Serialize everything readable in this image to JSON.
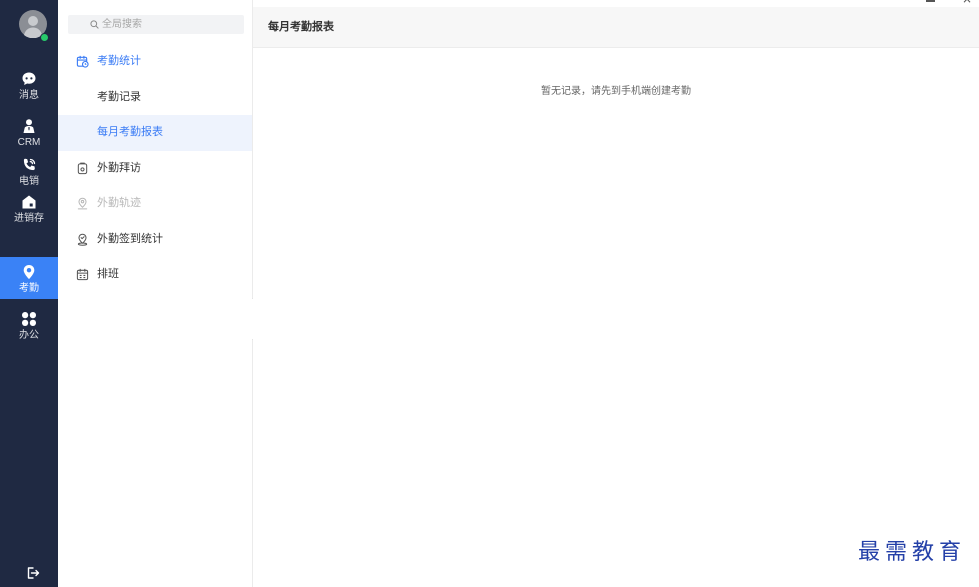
{
  "window_controls": {
    "minimize_icon": "minimize-icon",
    "close_icon": "close-icon",
    "close_glyph": "×"
  },
  "nav": {
    "avatar_icon": "user-avatar",
    "items": [
      {
        "label": "消息",
        "icon": "chat-icon",
        "active": false
      },
      {
        "label": "CRM",
        "icon": "user-icon",
        "active": false
      },
      {
        "label": "电销",
        "icon": "phone-icon",
        "active": false
      },
      {
        "label": "进销存",
        "icon": "store-icon",
        "active": false
      },
      {
        "label": "考勤",
        "icon": "location-pin-icon",
        "active": true
      },
      {
        "label": "办公",
        "icon": "apps-grid-icon",
        "active": false
      }
    ],
    "logout_icon": "logout-icon"
  },
  "submenu": {
    "search_icon": "search-icon",
    "search_placeholder": "全局搜索",
    "search_value": "",
    "items": [
      {
        "label": "考勤统计",
        "icon": "calendar-clock-icon",
        "group": true,
        "expanded": true
      },
      {
        "label": "考勤记录",
        "sub": true
      },
      {
        "label": "每月考勤报表",
        "sub": true,
        "active": true
      },
      {
        "label": "外勤拜访",
        "icon": "visit-card-icon"
      },
      {
        "label": "外勤轨迹",
        "icon": "track-pin-icon",
        "disabled": true
      },
      {
        "label": "外勤签到统计",
        "icon": "checkin-pin-icon"
      },
      {
        "label": "排班",
        "icon": "schedule-calendar-icon"
      }
    ],
    "collapse_icon": "collapse-left-icon"
  },
  "main": {
    "title": "每月考勤报表",
    "empty_text": "暂无记录，请先到手机端创建考勤"
  },
  "watermark": {
    "text": "最需教育"
  },
  "colors": {
    "sidebar_bg": "#1f2942",
    "nav_active_bg": "#3a82f6",
    "accent": "#3b7cf5",
    "submenu_active_bg": "#eef3fd",
    "disabled_text": "#b8b8b8",
    "header_bg": "#f7f7f7",
    "watermark": "#2440a8",
    "status": "#27c96a"
  }
}
